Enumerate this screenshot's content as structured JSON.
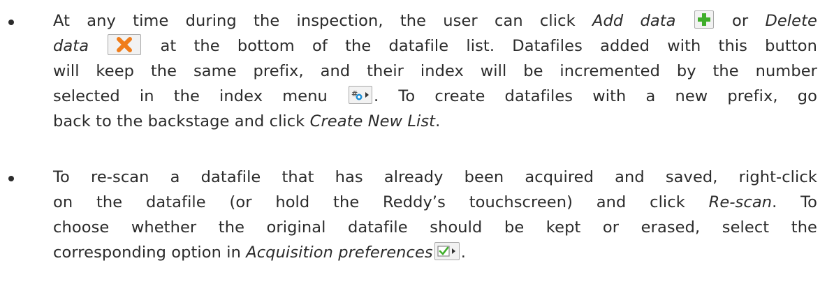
{
  "bullets": [
    {
      "segments": {
        "s1": "At any time during the inspection, the user can click ",
        "s2": "Add data",
        "s3": " or ",
        "s4": "Delete",
        "s5": "data",
        "s6": " at the bottom of the datafile list. Datafiles added with this button",
        "s7": "will keep the same prefix, and their index will be incremented by the number",
        "s8": "selected in the index menu ",
        "s9": ". To create datafiles with a new prefix, go",
        "s10": "back to the backstage and click ",
        "s11": "Create New List",
        "s12": "."
      }
    },
    {
      "segments": {
        "s1": "To re-scan a datafile that has already been acquired and saved, right-click",
        "s2": "on the datafile (or hold the Reddy’s touchscreen) and click ",
        "s3": "Re-scan",
        "s4": ". To",
        "s5": "choose whether the original datafile should be kept or erased, select the",
        "s6": "corresponding option in ",
        "s7": "Acquisition preferences",
        "s8": "."
      }
    }
  ],
  "icons": {
    "add_icon": "plus-icon",
    "delete_icon": "x-icon",
    "index_icon": "index-menu-icon",
    "prefs_icon": "checkbox-menu-icon"
  },
  "colors": {
    "text": "#2b2b2b",
    "add_green": "#3fae2a",
    "delete_orange": "#f07d1a",
    "index_blue": "#1d8fd6"
  }
}
